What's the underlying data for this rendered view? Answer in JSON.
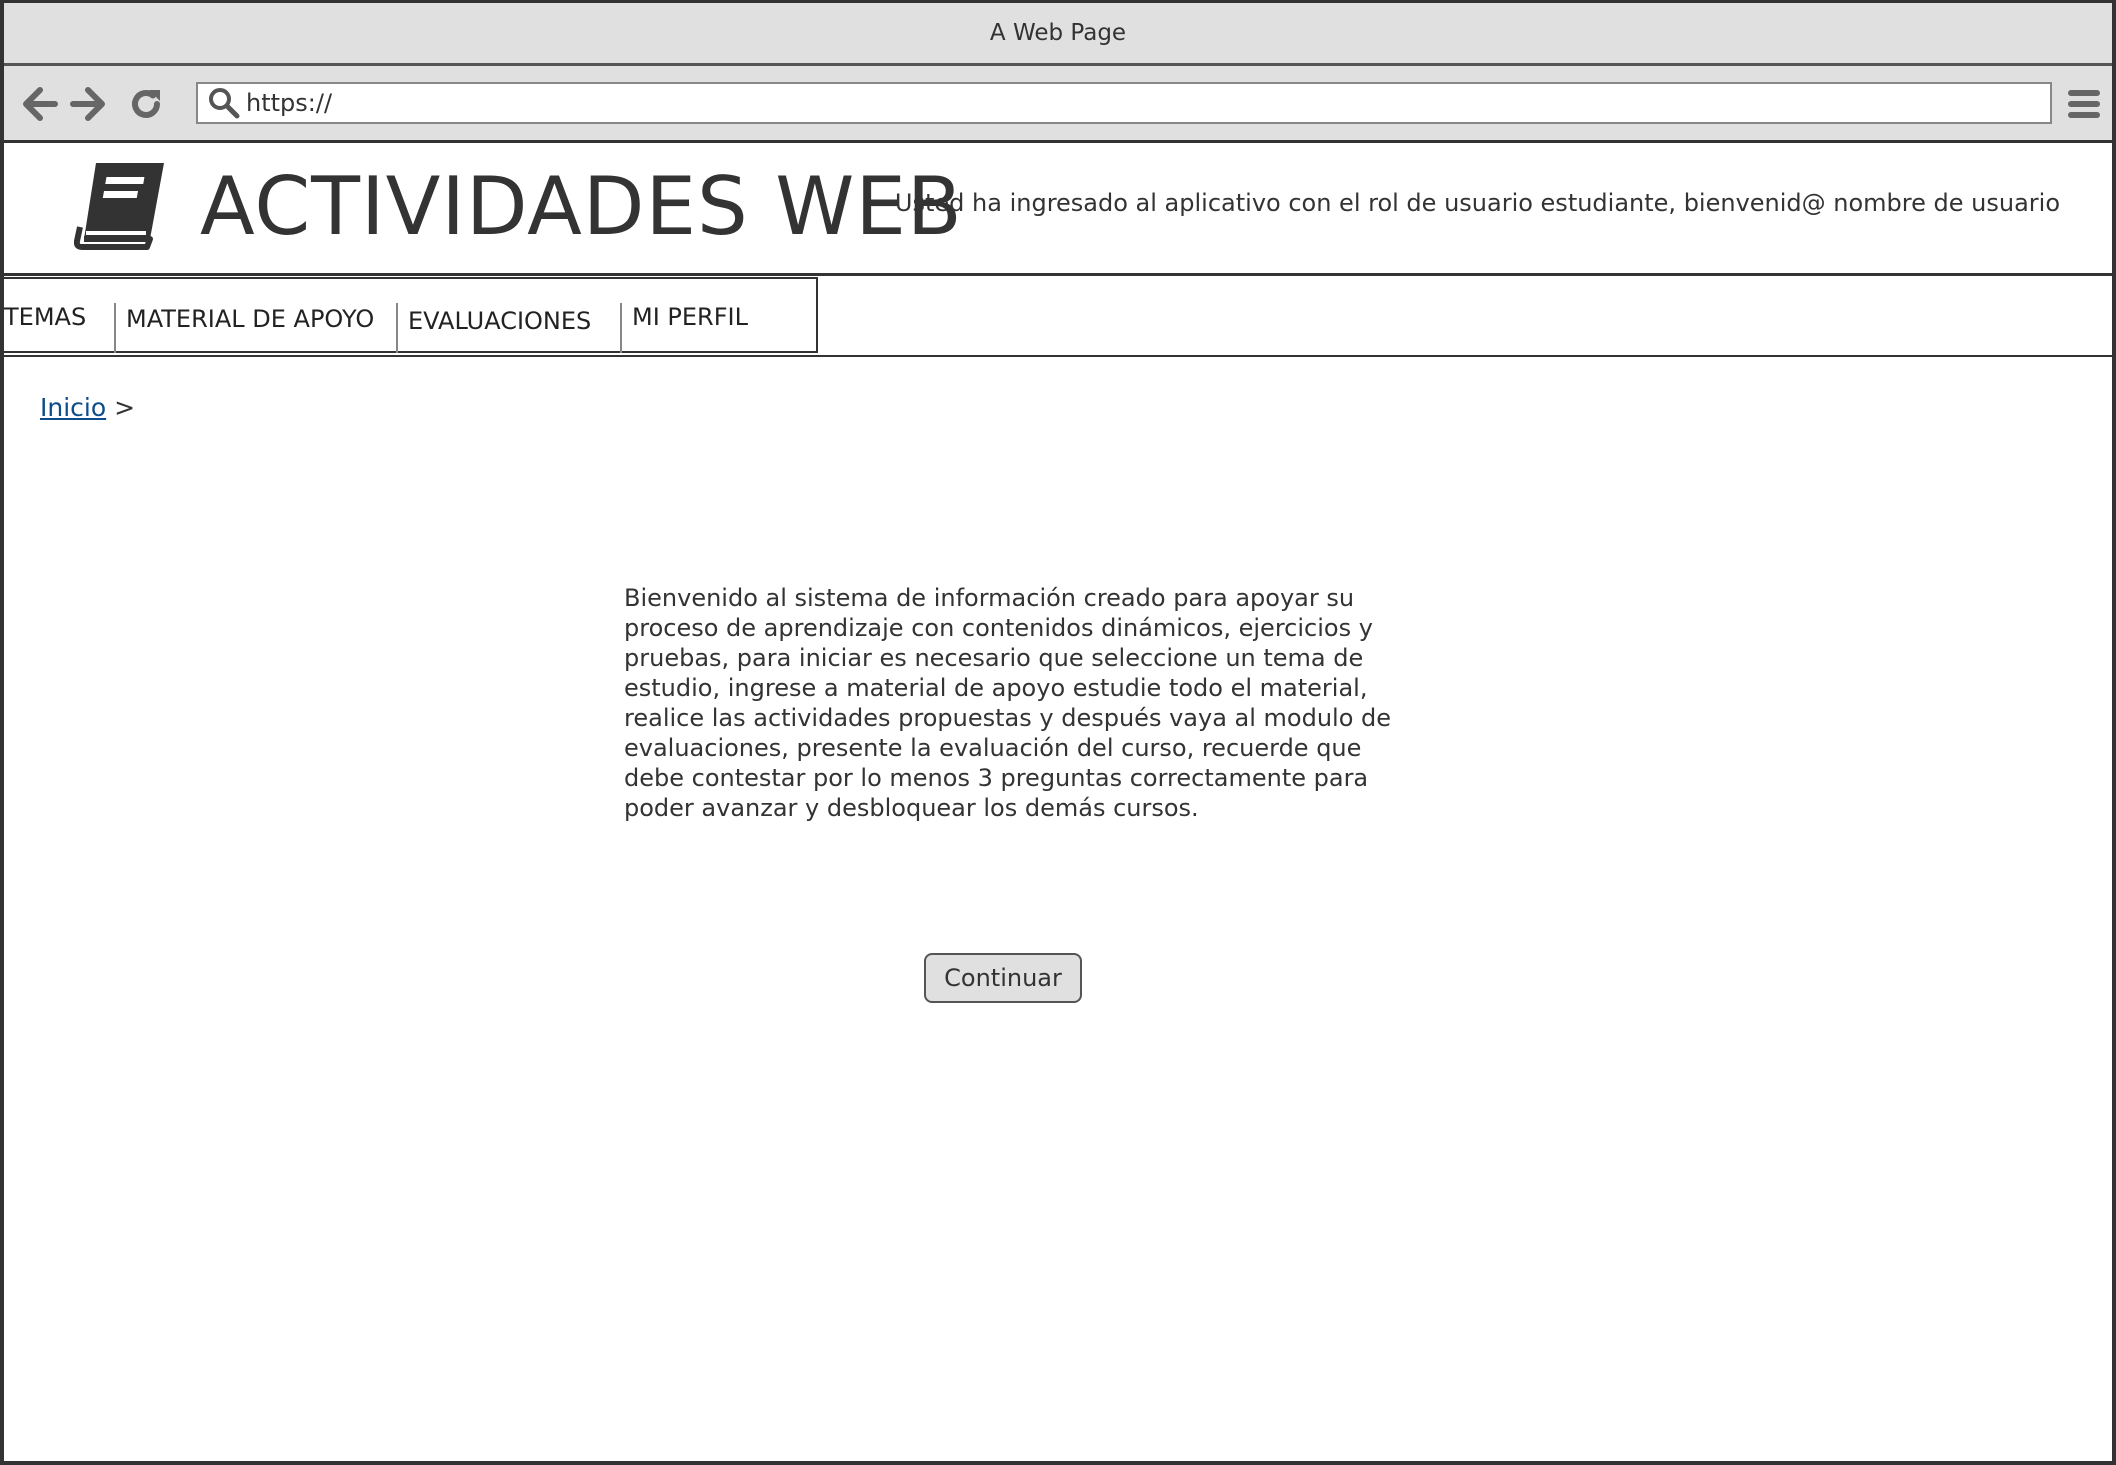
{
  "window": {
    "title": "A Web Page"
  },
  "browser": {
    "url": "https://",
    "icons": {
      "back": "arrow-left-icon",
      "forward": "arrow-right-icon",
      "reload": "reload-icon",
      "search": "search-icon",
      "menu": "hamburger-menu-icon"
    }
  },
  "header": {
    "logo_icon": "book-icon",
    "site_title": "ACTIVIDADES WEB",
    "welcome": "Usted ha ingresado al aplicativo con el rol de usuario estudiante, bienvenid@ nombre de usuario"
  },
  "tabs": [
    {
      "label": "TEMAS"
    },
    {
      "label": "MATERIAL DE APOYO"
    },
    {
      "label": "EVALUACIONES"
    },
    {
      "label": "MI PERFIL"
    }
  ],
  "breadcrumb": {
    "link": "Inicio",
    "separator": ">"
  },
  "main": {
    "intro": "Bienvenido al sistema de información creado para apoyar su proceso de aprendizaje con contenidos dinámicos, ejercicios y pruebas, para iniciar es necesario que seleccione un tema de estudio, ingrese a material de apoyo estudie todo el material, realice las actividades propuestas y después vaya al modulo de evaluaciones, presente la evaluación del curso, recuerde que debe contestar por lo menos 3 preguntas correctamente para poder avanzar y desbloquear los demás cursos.",
    "continue_label": "Continuar"
  },
  "colors": {
    "chrome": "#e0e0e0",
    "border": "#333333",
    "text": "#333333",
    "link": "#0d4c8c"
  }
}
